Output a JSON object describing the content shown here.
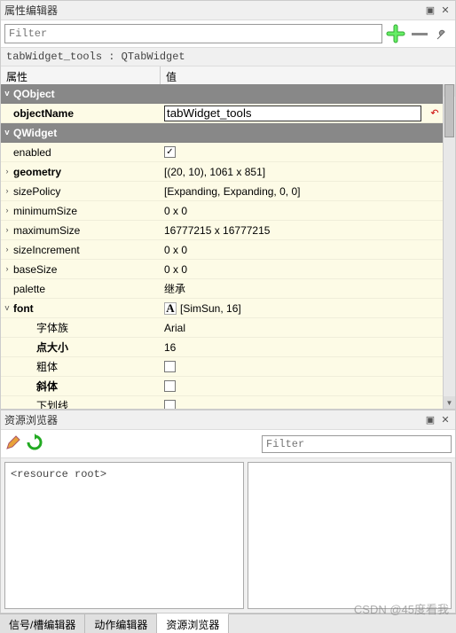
{
  "property_editor": {
    "title": "属性编辑器",
    "filter_placeholder": "Filter",
    "object_label": "tabWidget_tools : QTabWidget",
    "columns": {
      "name": "属性",
      "value": "值"
    },
    "groups": [
      {
        "label": "QObject",
        "expanded": true
      },
      {
        "label": "QWidget",
        "expanded": true
      }
    ],
    "props": {
      "objectName": {
        "label": "objectName",
        "value": "tabWidget_tools",
        "bold": true,
        "indent": 1,
        "has_reset": true,
        "editing": true
      },
      "enabled": {
        "label": "enabled",
        "checked": true,
        "indent": 1
      },
      "geometry": {
        "label": "geometry",
        "value": "[(20, 10), 1061 x 851]",
        "bold": true,
        "indent": 1,
        "expandable": true
      },
      "sizePolicy": {
        "label": "sizePolicy",
        "value": "[Expanding, Expanding, 0, 0]",
        "indent": 1,
        "expandable": true
      },
      "minimumSize": {
        "label": "minimumSize",
        "value": "0 x 0",
        "indent": 1,
        "expandable": true
      },
      "maximumSize": {
        "label": "maximumSize",
        "value": "16777215 x 16777215",
        "indent": 1,
        "expandable": true
      },
      "sizeIncrement": {
        "label": "sizeIncrement",
        "value": "0 x 0",
        "indent": 1,
        "expandable": true
      },
      "baseSize": {
        "label": "baseSize",
        "value": "0 x 0",
        "indent": 1,
        "expandable": true
      },
      "palette": {
        "label": "palette",
        "value": "继承",
        "indent": 1
      },
      "font": {
        "label": "font",
        "value": "[SimSun, 16]",
        "bold": true,
        "indent": 1,
        "expandable": true,
        "expanded": true,
        "has_icon": true
      },
      "fontFamily": {
        "label": "字体族",
        "value": "Arial",
        "indent": 2
      },
      "fontSize": {
        "label": "点大小",
        "value": "16",
        "bold": true,
        "indent": 2
      },
      "fontBold": {
        "label": "粗体",
        "checked": false,
        "indent": 2
      },
      "fontItalic": {
        "label": "斜体",
        "checked": false,
        "bold": true,
        "indent": 2
      },
      "fontUnderline": {
        "label": "下划线",
        "checked": false,
        "indent": 2
      }
    }
  },
  "resource_browser": {
    "title": "资源浏览器",
    "filter_placeholder": "Filter",
    "root_text": "<resource root>"
  },
  "tabs": {
    "signal": "信号/槽编辑器",
    "action": "动作编辑器",
    "resource": "资源浏览器"
  },
  "watermark": "CSDN @45度看我"
}
